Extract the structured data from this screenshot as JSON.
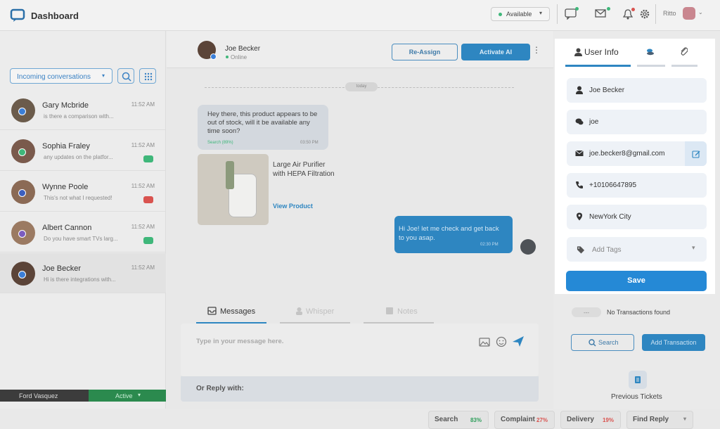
{
  "app": {
    "title": "Dashboard"
  },
  "topbar": {
    "status": "Available",
    "user": "Ritto"
  },
  "sidebar": {
    "dropdown": "Incoming conversations",
    "conversations": [
      {
        "name": "Gary Mcbride",
        "preview": "is there a comparison with...",
        "time": "11:52 AM"
      },
      {
        "name": "Sophia Fraley",
        "preview": "any updates on the platfor...",
        "time": "11:52 AM"
      },
      {
        "name": "Wynne Poole",
        "preview": "This's not what I requested!",
        "time": "11:52 AM"
      },
      {
        "name": "Albert Cannon",
        "preview": "Do you have smart TVs larg...",
        "time": "11:52 AM"
      },
      {
        "name": "Joe Becker",
        "preview": "Hi is there integrations with...",
        "time": "11:52 AM"
      }
    ],
    "agent_name": "Ford Vasquez",
    "agent_status": "Active"
  },
  "chat": {
    "contact_name": "Joe Becker",
    "contact_status": "Online",
    "reassign_label": "Re-Assign",
    "activate_label": "Activate AI",
    "date_divider": "today",
    "incoming_message": "Hey there, this product appears to be out of stock, will it be available any time soon?",
    "incoming_tag": "Search (89%)",
    "incoming_time": "03:50 PM",
    "product_name": "Large Air Purifier with HEPA Filtration",
    "product_link": "View Product",
    "outgoing_message": "Hi Joe! let me check and get back to you asap.",
    "outgoing_time": "02:30 PM",
    "tabs": [
      "Messages",
      "Whisper",
      "Notes"
    ],
    "input_placeholder": "Type in your message here.",
    "reply_label": "Or Reply with:",
    "replies": [
      {
        "label": "Search",
        "pct": "83%",
        "color": "#2e9e5b"
      },
      {
        "label": "Complaint",
        "pct": "27%",
        "color": "#d9534f"
      },
      {
        "label": "Delivery",
        "pct": "19%",
        "color": "#d9534f"
      }
    ],
    "find_reply": "Find Reply"
  },
  "panel": {
    "tab_label": "User Info",
    "name": "Joe Becker",
    "nickname": "joe",
    "email": "joe.becker8@gmail.com",
    "phone": "+10106647895",
    "location": "NewYork City",
    "tags_placeholder": "Add Tags",
    "save_label": "Save",
    "transactions_dash": "---",
    "no_transactions": "No Transactions found",
    "search_label": "Search",
    "add_transaction": "Add Transaction",
    "previous_tickets": "Previous Tickets"
  },
  "colors": {
    "accent": "#1f88d6",
    "green": "#3fb77a",
    "brand_dark": "#2a6fa8"
  }
}
